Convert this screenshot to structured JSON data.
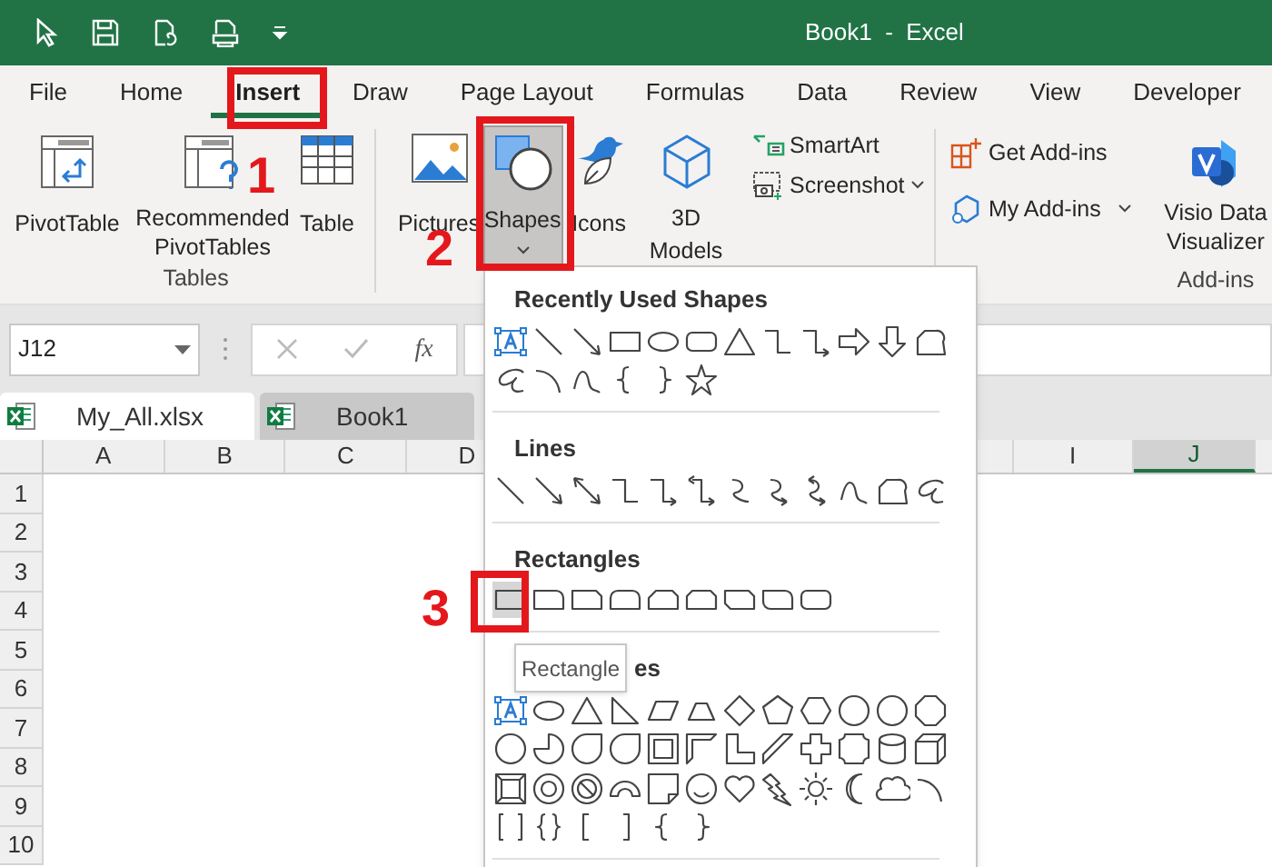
{
  "title_bar": {
    "title": "Book1  -  Excel"
  },
  "ribbon_tabs": [
    {
      "label": "File",
      "selected": false
    },
    {
      "label": "Home",
      "selected": false
    },
    {
      "label": "Insert",
      "selected": true
    },
    {
      "label": "Draw",
      "selected": false
    },
    {
      "label": "Page Layout",
      "selected": false
    },
    {
      "label": "Formulas",
      "selected": false
    },
    {
      "label": "Data",
      "selected": false
    },
    {
      "label": "Review",
      "selected": false
    },
    {
      "label": "View",
      "selected": false
    },
    {
      "label": "Developer",
      "selected": false
    }
  ],
  "ribbon": {
    "tables": {
      "label": "Tables",
      "buttons": [
        "PivotTable",
        "Recommended PivotTables",
        "Table"
      ]
    },
    "illustrations": {
      "pictures": "Pictures",
      "shapes": {
        "label": "Shapes",
        "pressed": true
      },
      "icons": "Icons",
      "models": "3D Models",
      "smartart": "SmartArt",
      "screenshot": "Screenshot"
    },
    "addins": {
      "label": "Add-ins",
      "get": "Get Add-ins",
      "mine": "My Add-ins",
      "visio": "Visio Data Visualizer"
    }
  },
  "formula_bar": {
    "name_box": "J12",
    "function_label": "fx"
  },
  "workbook_tabs": [
    {
      "label": "My_All.xlsx",
      "selected": true
    },
    {
      "label": "Book1",
      "selected": false
    }
  ],
  "sheet": {
    "columns": [
      {
        "label": "A",
        "selected": false
      },
      {
        "label": "B",
        "selected": false
      },
      {
        "label": "C",
        "selected": false
      },
      {
        "label": "D",
        "selected": false
      },
      {
        "label": "I",
        "selected": false
      },
      {
        "label": "J",
        "selected": true
      }
    ],
    "rows": [
      "1",
      "2",
      "3",
      "4",
      "5",
      "6",
      "7",
      "8",
      "9",
      "10"
    ]
  },
  "shapes_menu": {
    "sections": [
      {
        "heading": "Recently Used Shapes"
      },
      {
        "heading": "Lines"
      },
      {
        "heading": "Rectangles"
      },
      {
        "heading": "es"
      }
    ],
    "tooltip": "Rectangle"
  },
  "annotations": [
    "1",
    "2",
    "3"
  ]
}
